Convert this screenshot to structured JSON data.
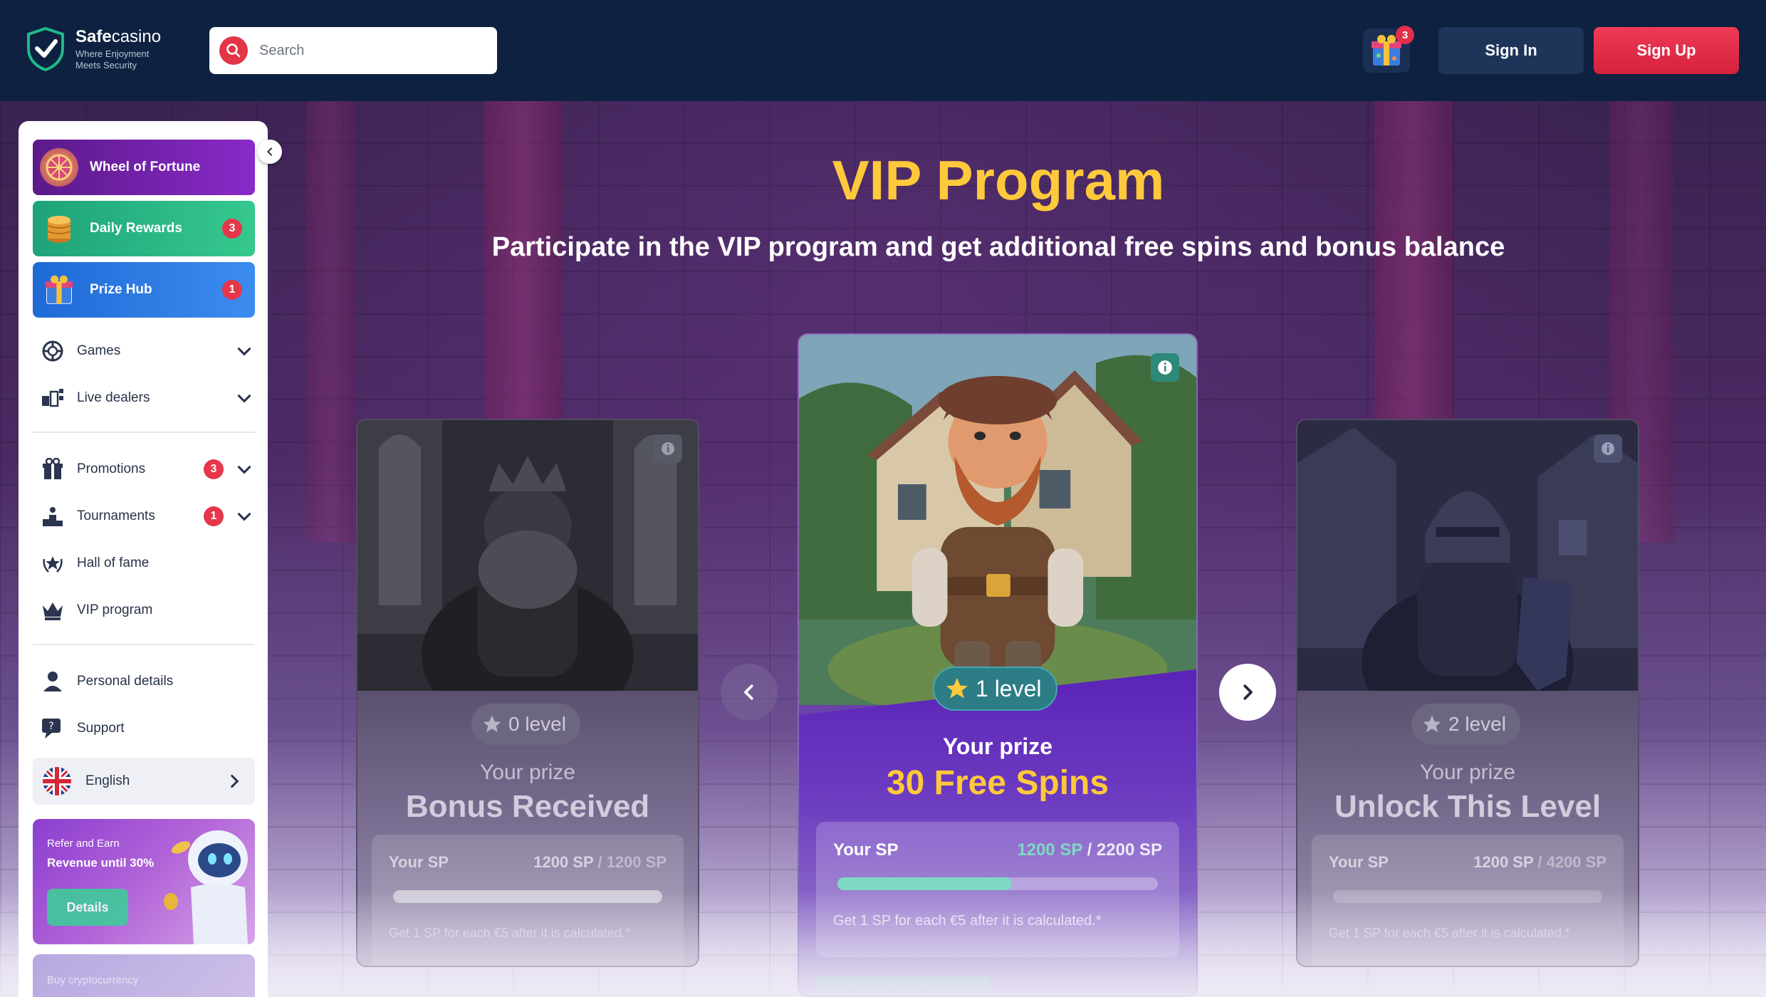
{
  "header": {
    "brand": "Safecasino",
    "brand_bold": "Safe",
    "brand_rest": "casino",
    "tagline_1": "Where Enjoyment",
    "tagline_2": "Meets Security",
    "search_placeholder": "Search",
    "gift_badge": "3",
    "signin_label": "Sign In",
    "signup_label": "Sign Up"
  },
  "sidebar": {
    "featured": [
      {
        "label": "Wheel of Fortune",
        "badge": ""
      },
      {
        "label": "Daily Rewards",
        "badge": "3"
      },
      {
        "label": "Prize Hub",
        "badge": "1"
      }
    ],
    "nav": [
      {
        "label": "Games",
        "badge": ""
      },
      {
        "label": "Live dealers",
        "badge": ""
      },
      {
        "label": "Promotions",
        "badge": "3"
      },
      {
        "label": "Tournaments",
        "badge": "1"
      },
      {
        "label": "Hall of fame",
        "badge": ""
      },
      {
        "label": "VIP program",
        "badge": ""
      },
      {
        "label": "Personal details",
        "badge": ""
      },
      {
        "label": "Support",
        "badge": ""
      }
    ],
    "language": "English",
    "refer": {
      "line1": "Refer and Earn",
      "line2": "Revenue until 30%",
      "button": "Details"
    },
    "buy_crypto": "Buy cryptocurrency"
  },
  "vip": {
    "title": "VIP Program",
    "subtitle": "Participate in the VIP program and get additional free spins and bonus balance",
    "cards": [
      {
        "level": "0 level",
        "prize_label": "Your prize",
        "prize": "Bonus Received",
        "sp_label": "Your SP",
        "sp_current": "1200 SP",
        "sp_sep": " / ",
        "sp_target": "1200 SP",
        "progress": 1.0,
        "note": "Get 1 SP for each €5 after it is calculated.*"
      },
      {
        "level": "1 level",
        "prize_label": "Your prize",
        "prize": "30 Free Spins",
        "sp_label": "Your SP",
        "sp_current": "1200 SP",
        "sp_sep": " / ",
        "sp_target": "2200 SP",
        "progress": 0.545,
        "note": "Get 1 SP for each €5 after it is calculated.*"
      },
      {
        "level": "2 level",
        "prize_label": "Your prize",
        "prize": "Unlock This Level",
        "sp_label": "Your SP",
        "sp_current": "1200 SP",
        "sp_sep": " / ",
        "sp_target": "4200 SP",
        "progress": 0.0,
        "note": "Get 1 SP for each €5 after it is calculated.*"
      }
    ]
  },
  "colors": {
    "accent_gold": "#ffc93b",
    "signup_red": "#e32d4a",
    "progress_teal": "#7fd8c4"
  }
}
